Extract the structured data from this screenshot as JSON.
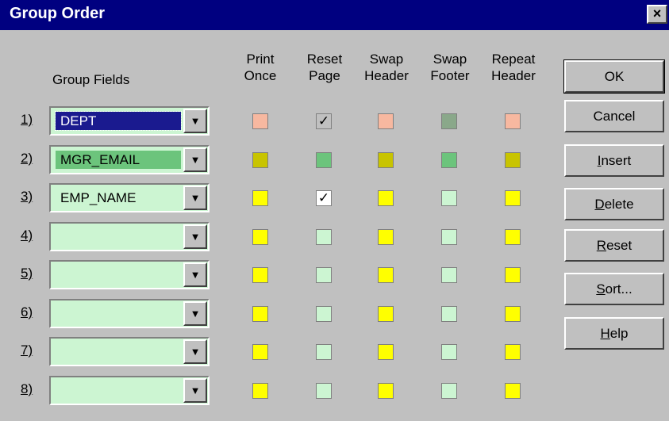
{
  "window": {
    "title": "Group Order",
    "close_label": "×"
  },
  "group_fields_label": "Group Fields",
  "columns": [
    "Print\nOnce",
    "Reset\nPage",
    "Swap\nHeader",
    "Swap\nFooter",
    "Repeat\nHeader"
  ],
  "rows": [
    {
      "num": "1)",
      "value": "DEPT",
      "field_bg": "#1a1a8f",
      "field_fg": "#ffffff",
      "selected": true,
      "boxes": [
        {
          "color": "#f7b8a0",
          "checked": false
        },
        {
          "color": "#c0c0c0",
          "checked": true
        },
        {
          "color": "#f7b8a0",
          "checked": false
        },
        {
          "color": "#8aa88a",
          "checked": false
        },
        {
          "color": "#f7b8a0",
          "checked": false
        }
      ]
    },
    {
      "num": "2)",
      "value": "MGR_EMAIL",
      "field_bg": "#6cc47c",
      "field_fg": "#000000",
      "boxes": [
        {
          "color": "#c8c400",
          "checked": false
        },
        {
          "color": "#6cc47c",
          "checked": false
        },
        {
          "color": "#c8c400",
          "checked": false
        },
        {
          "color": "#6cc47c",
          "checked": false
        },
        {
          "color": "#c8c400",
          "checked": false
        }
      ]
    },
    {
      "num": "3)",
      "value": "EMP_NAME",
      "field_bg": "#ccf5d2",
      "field_fg": "#000000",
      "boxes": [
        {
          "color": "#ffff00",
          "checked": false
        },
        {
          "color": "#ffffff",
          "checked": true
        },
        {
          "color": "#ffff00",
          "checked": false
        },
        {
          "color": "#ccf5d2",
          "checked": false
        },
        {
          "color": "#ffff00",
          "checked": false
        }
      ]
    },
    {
      "num": "4)",
      "value": "",
      "field_bg": "#ccf5d2",
      "field_fg": "#000000",
      "boxes": [
        {
          "color": "#ffff00",
          "checked": false
        },
        {
          "color": "#ccf5d2",
          "checked": false
        },
        {
          "color": "#ffff00",
          "checked": false
        },
        {
          "color": "#ccf5d2",
          "checked": false
        },
        {
          "color": "#ffff00",
          "checked": false
        }
      ]
    },
    {
      "num": "5)",
      "value": "",
      "field_bg": "#ccf5d2",
      "field_fg": "#000000",
      "boxes": [
        {
          "color": "#ffff00",
          "checked": false
        },
        {
          "color": "#ccf5d2",
          "checked": false
        },
        {
          "color": "#ffff00",
          "checked": false
        },
        {
          "color": "#ccf5d2",
          "checked": false
        },
        {
          "color": "#ffff00",
          "checked": false
        }
      ]
    },
    {
      "num": "6)",
      "value": "",
      "field_bg": "#ccf5d2",
      "field_fg": "#000000",
      "boxes": [
        {
          "color": "#ffff00",
          "checked": false
        },
        {
          "color": "#ccf5d2",
          "checked": false
        },
        {
          "color": "#ffff00",
          "checked": false
        },
        {
          "color": "#ccf5d2",
          "checked": false
        },
        {
          "color": "#ffff00",
          "checked": false
        }
      ]
    },
    {
      "num": "7)",
      "value": "",
      "field_bg": "#ccf5d2",
      "field_fg": "#000000",
      "boxes": [
        {
          "color": "#ffff00",
          "checked": false
        },
        {
          "color": "#ccf5d2",
          "checked": false
        },
        {
          "color": "#ffff00",
          "checked": false
        },
        {
          "color": "#ccf5d2",
          "checked": false
        },
        {
          "color": "#ffff00",
          "checked": false
        }
      ]
    },
    {
      "num": "8)",
      "value": "",
      "field_bg": "#ccf5d2",
      "field_fg": "#000000",
      "boxes": [
        {
          "color": "#ffff00",
          "checked": false
        },
        {
          "color": "#ccf5d2",
          "checked": false
        },
        {
          "color": "#ffff00",
          "checked": false
        },
        {
          "color": "#ccf5d2",
          "checked": false
        },
        {
          "color": "#ffff00",
          "checked": false
        }
      ]
    }
  ],
  "buttons": [
    {
      "key": "ok",
      "label": "OK",
      "accel": ""
    },
    {
      "key": "cancel",
      "label": "Cancel",
      "accel": ""
    },
    {
      "key": "insert",
      "label": "nsert",
      "accel": "I"
    },
    {
      "key": "delete",
      "label": "elete",
      "accel": "D"
    },
    {
      "key": "reset",
      "label": "eset",
      "accel": "R"
    },
    {
      "key": "sort",
      "label": "ort...",
      "accel": "S"
    },
    {
      "key": "help",
      "label": "elp",
      "accel": "H"
    }
  ],
  "dropdown_arrow": "▼",
  "check_mark": "✓"
}
